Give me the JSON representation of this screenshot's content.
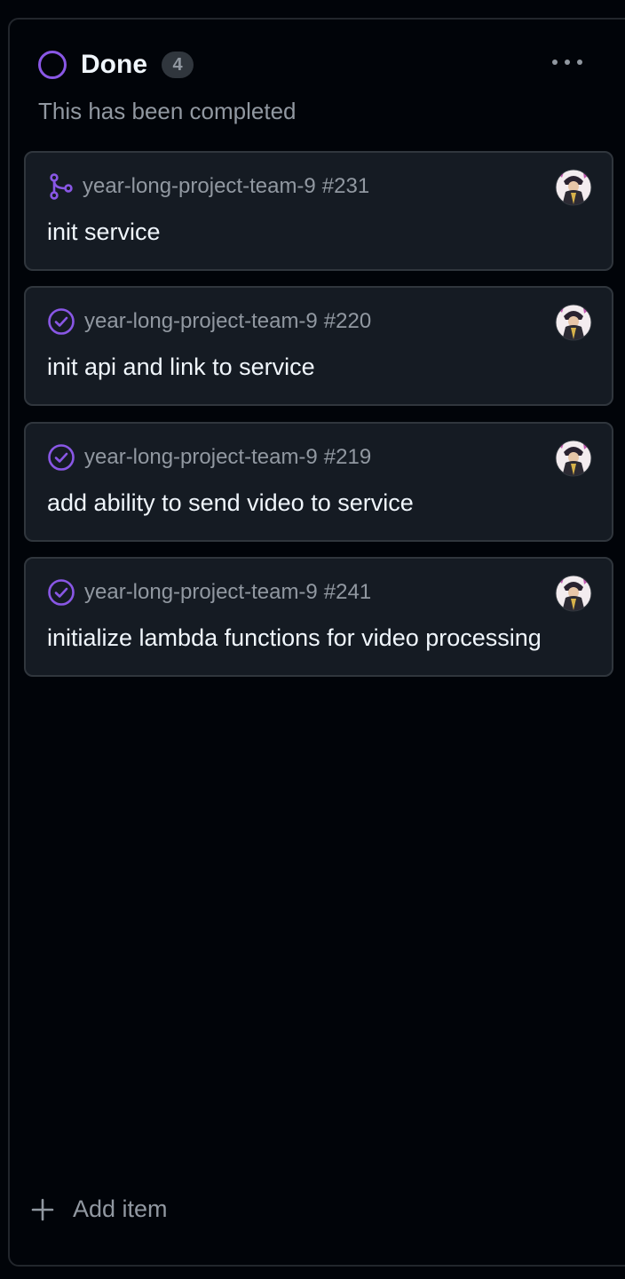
{
  "column": {
    "title": "Done",
    "count": "4",
    "description": "This has been completed",
    "status_color": "#8957e5",
    "more_icon": "kebab-horizontal-icon"
  },
  "cards": [
    {
      "type_icon": "pull-request-merged-icon",
      "repo": "year-long-project-team-9",
      "number": "#231",
      "title": "init service"
    },
    {
      "type_icon": "issue-closed-icon",
      "repo": "year-long-project-team-9",
      "number": "#220",
      "title": "init api and link to service"
    },
    {
      "type_icon": "issue-closed-icon",
      "repo": "year-long-project-team-9",
      "number": "#219",
      "title": "add ability to send video to service"
    },
    {
      "type_icon": "issue-closed-icon",
      "repo": "year-long-project-team-9",
      "number": "#241",
      "title": "initialize lambda functions for video processing"
    }
  ],
  "footer": {
    "add_label": "Add item",
    "add_icon": "plus-icon"
  },
  "colors": {
    "background": "#010409",
    "card_bg": "#151b23",
    "border": "#30363d",
    "text_primary": "#f0f6fc",
    "text_muted": "#9198a1",
    "accent_purple": "#8957e5"
  }
}
